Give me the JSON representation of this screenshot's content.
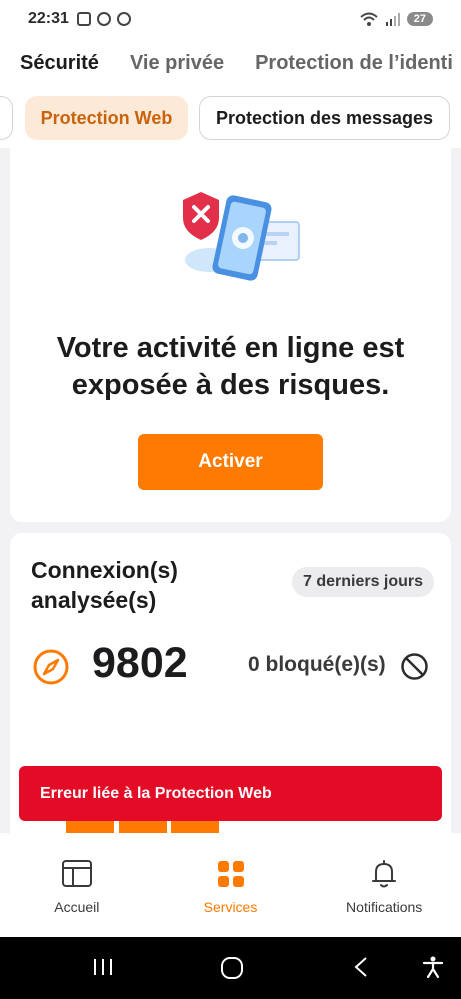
{
  "status_bar": {
    "time": "22:31",
    "battery": "27"
  },
  "top_tabs": [
    "Sécurité",
    "Vie privée",
    "Protection de l’identi"
  ],
  "sub_tabs": {
    "web": "Protection Web",
    "messages": "Protection des messages"
  },
  "hero": {
    "title": "Votre activité en ligne est exposée à des risques.",
    "button": "Activer"
  },
  "stats": {
    "title": "Connexion(s) analysée(s)",
    "period": "7 derniers jours",
    "count": "9802",
    "blocked": "0 bloqué(e)(s)"
  },
  "error_banner": "Erreur liée à la Protection Web",
  "bottom_nav": {
    "home": "Accueil",
    "services": "Services",
    "notifications": "Notifications"
  },
  "colors": {
    "accent": "#ff7a00",
    "error": "#e30b25",
    "chip_bg": "#fde9d8",
    "chip_text": "#c9630a"
  },
  "icons": [
    "shield-phone-illustration",
    "compass-icon",
    "blocked-icon",
    "dashboard-icon",
    "grid-icon",
    "bell-icon",
    "recents-icon",
    "home-circle-icon",
    "back-icon",
    "accessibility-icon"
  ]
}
